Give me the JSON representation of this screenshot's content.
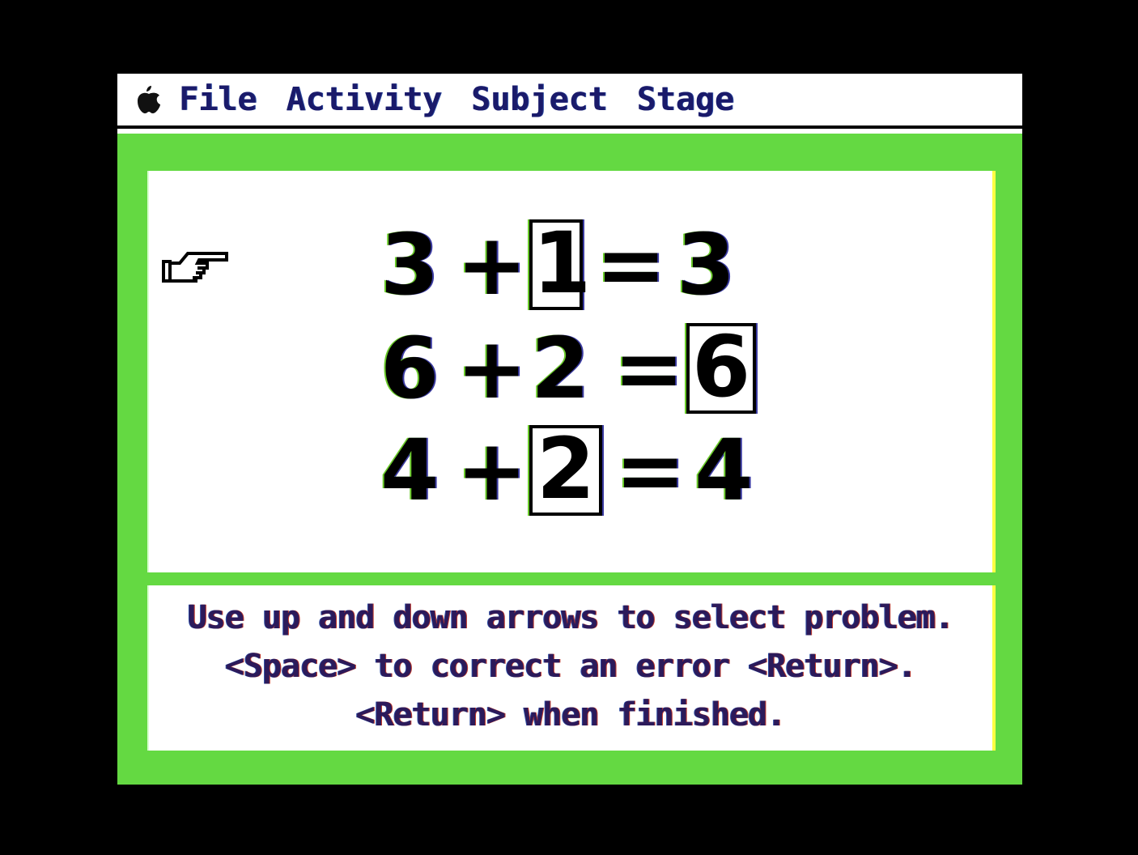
{
  "menubar": {
    "apple_icon": "apple-logo-icon",
    "items": [
      "File",
      "Activity",
      "Subject",
      "Stage"
    ]
  },
  "problems": [
    {
      "a": "3",
      "op": "+",
      "b": "1",
      "eq": "=",
      "result": "3",
      "boxed": "b"
    },
    {
      "a": "6",
      "op": "+",
      "b": "2",
      "eq": "=",
      "result": "6",
      "boxed": "result"
    },
    {
      "a": "4",
      "op": "+",
      "b": "2",
      "eq": "=",
      "result": "4",
      "boxed": "b"
    }
  ],
  "selected_problem": 0,
  "pointer_icon": "pointing-hand-icon",
  "instructions": [
    "Use up and down arrows to select problem.",
    "<Space> to correct an error <Return>.",
    "<Return> when finished."
  ],
  "colors": {
    "frame": "#000000",
    "screen_background": "#64d942",
    "panel": "#ffffff",
    "menu_text": "#1a1a6a",
    "instruction_text": "#2c1a5a"
  }
}
